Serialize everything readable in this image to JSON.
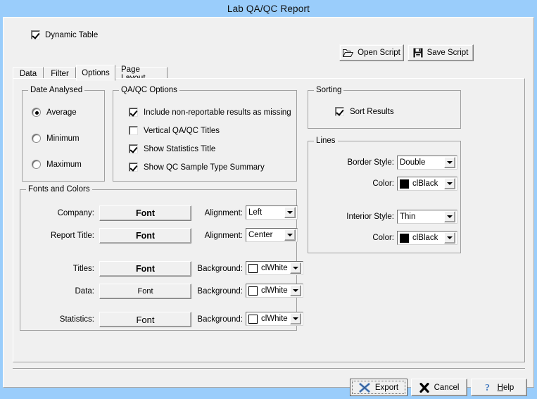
{
  "window": {
    "title": "Lab QA/QC Report",
    "titlebar_color": "#9acdfb",
    "face_color": "#f0f0f0"
  },
  "toolbar": {
    "dynamic_table_label": "Dynamic Table",
    "dynamic_table_checked": true,
    "open_script_label": "Open Script",
    "save_script_label": "Save Script"
  },
  "tabs": [
    {
      "label": "Data",
      "active": false
    },
    {
      "label": "Filter",
      "active": false
    },
    {
      "label": "Options",
      "active": true
    },
    {
      "label": "Page Layout",
      "active": false
    }
  ],
  "date_analysed": {
    "title": "Date Analysed",
    "options": [
      {
        "label": "Average",
        "selected": true
      },
      {
        "label": "Minimum",
        "selected": false
      },
      {
        "label": "Maximum",
        "selected": false
      }
    ]
  },
  "qaqc_options": {
    "title": "QA/QC Options",
    "items": [
      {
        "label": "Include non-reportable results as missing",
        "checked": true
      },
      {
        "label": "Vertical QA/QC Titles",
        "checked": false
      },
      {
        "label": "Show Statistics Title",
        "checked": true
      },
      {
        "label": "Show QC Sample Type Summary",
        "checked": true
      }
    ]
  },
  "sorting": {
    "title": "Sorting",
    "sort_results_label": "Sort Results",
    "sort_results_checked": true
  },
  "lines": {
    "title": "Lines",
    "border_style_label": "Border Style:",
    "border_style_value": "Double",
    "border_color_label": "Color:",
    "border_color_value": "clBlack",
    "border_color_hex": "#000000",
    "interior_style_label": "Interior Style:",
    "interior_style_value": "Thin",
    "interior_color_label": "Color:",
    "interior_color_value": "clBlack",
    "interior_color_hex": "#000000"
  },
  "fonts_and_colors": {
    "title": "Fonts and Colors",
    "rows": [
      {
        "label": "Company:",
        "button": "Font",
        "right_label": "Alignment:",
        "value": "Left",
        "swatch": null
      },
      {
        "label": "Report Title:",
        "button": "Font",
        "right_label": "Alignment:",
        "value": "Center",
        "swatch": null
      },
      {
        "label": "Titles:",
        "button": "Font",
        "right_label": "Background:",
        "value": "clWhite",
        "swatch": "#ffffff"
      },
      {
        "label": "Data:",
        "button": "Font",
        "right_label": "Background:",
        "value": "clWhite",
        "swatch": "#ffffff"
      },
      {
        "label": "Statistics:",
        "button": "Font",
        "right_label": "Background:",
        "value": "clWhite",
        "swatch": "#ffffff"
      }
    ]
  },
  "footer": {
    "export_label": "Export",
    "cancel_label": "Cancel",
    "help_label_prefix": "H",
    "help_label_rest": "elp"
  },
  "icons": {
    "open_folder": "open-folder-icon",
    "save_floppy": "floppy-disk-icon",
    "export_x": "export-x-icon",
    "cancel_x": "cancel-x-icon",
    "help_question": "question-mark-icon"
  }
}
